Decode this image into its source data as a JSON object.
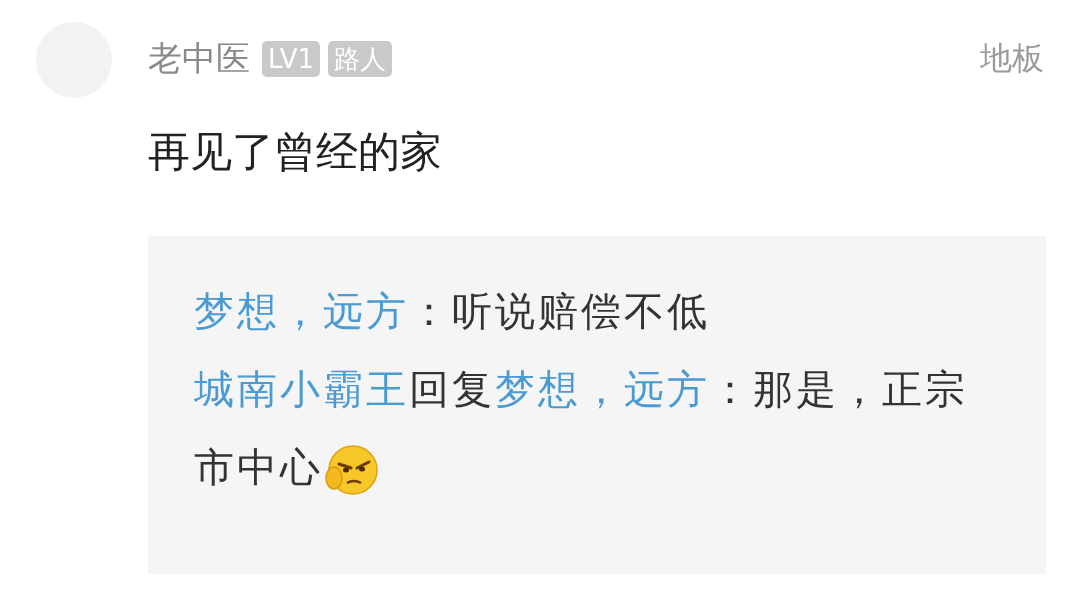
{
  "post": {
    "author": "老中医",
    "badges": [
      "LV1",
      "路人"
    ],
    "floor": "地板",
    "content": "再见了曾经的家"
  },
  "replies": [
    {
      "segments": [
        {
          "kind": "name",
          "text": "梦想，远方"
        },
        {
          "kind": "plain",
          "text": "：听说赔偿不低"
        }
      ],
      "emoji": false
    },
    {
      "segments": [
        {
          "kind": "name",
          "text": "城南小霸王"
        },
        {
          "kind": "plain",
          "text": "回复"
        },
        {
          "kind": "name",
          "text": "梦想，远方"
        },
        {
          "kind": "plain",
          "text": "：那是，正宗市中心"
        }
      ],
      "emoji": true
    }
  ]
}
